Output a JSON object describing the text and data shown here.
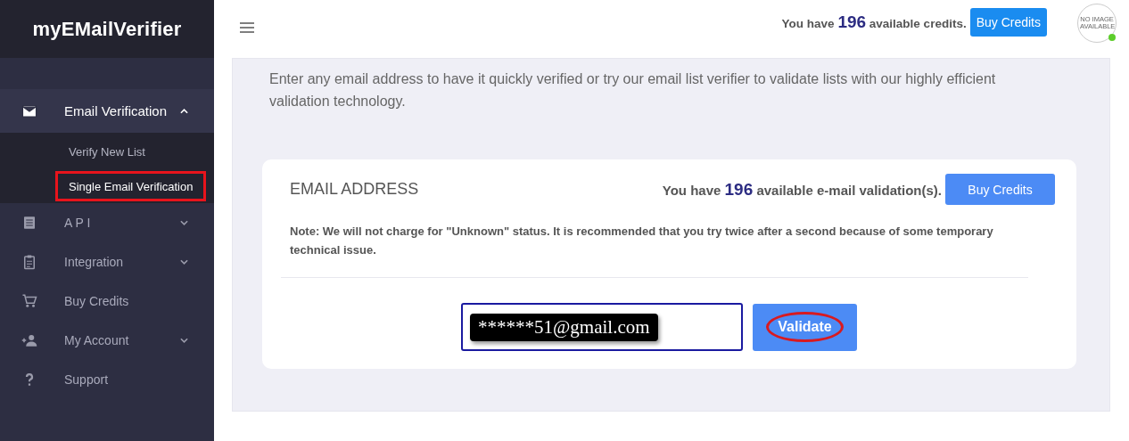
{
  "logo": {
    "text": "myEMailVerifier"
  },
  "sidebar": {
    "items": [
      {
        "kind": "mail",
        "label": "Email Verification",
        "has_submenu": true,
        "expanded": true,
        "children": [
          {
            "label": "Verify New List",
            "highlighted": false
          },
          {
            "label": "Single Email Verification",
            "highlighted": true
          }
        ]
      },
      {
        "kind": "doc",
        "label": "A P I",
        "has_submenu": true,
        "expanded": false
      },
      {
        "kind": "clipboard",
        "label": "Integration",
        "has_submenu": true,
        "expanded": false
      },
      {
        "kind": "cart",
        "label": "Buy Credits",
        "has_submenu": false,
        "expanded": false
      },
      {
        "kind": "person",
        "label": "My Account",
        "has_submenu": true,
        "expanded": false
      },
      {
        "kind": "help",
        "label": "Support",
        "has_submenu": false,
        "expanded": false
      }
    ]
  },
  "header": {
    "credits_before": "You have",
    "credits_count": "196",
    "credits_after": "available credits.",
    "button": "Buy Credits",
    "avatar_text": "NO IMAGE AVAILABLE",
    "online": true
  },
  "intro": "Enter any email address to have it quickly verified or try our email list verifier to validate lists with our highly efficient validation technology.",
  "card": {
    "title": "EMAIL ADDRESS",
    "credits_before": "You have",
    "credits_count": "196",
    "credits_after": "available e-mail validation(s).",
    "button": "Buy Credits",
    "note": "Note: We will not charge for \"Unknown\" status. It is recommended that you try twice after a second because of some temporary technical issue.",
    "email_value": "******51@gmail.com",
    "validate": "Validate",
    "validate_circled": true
  }
}
